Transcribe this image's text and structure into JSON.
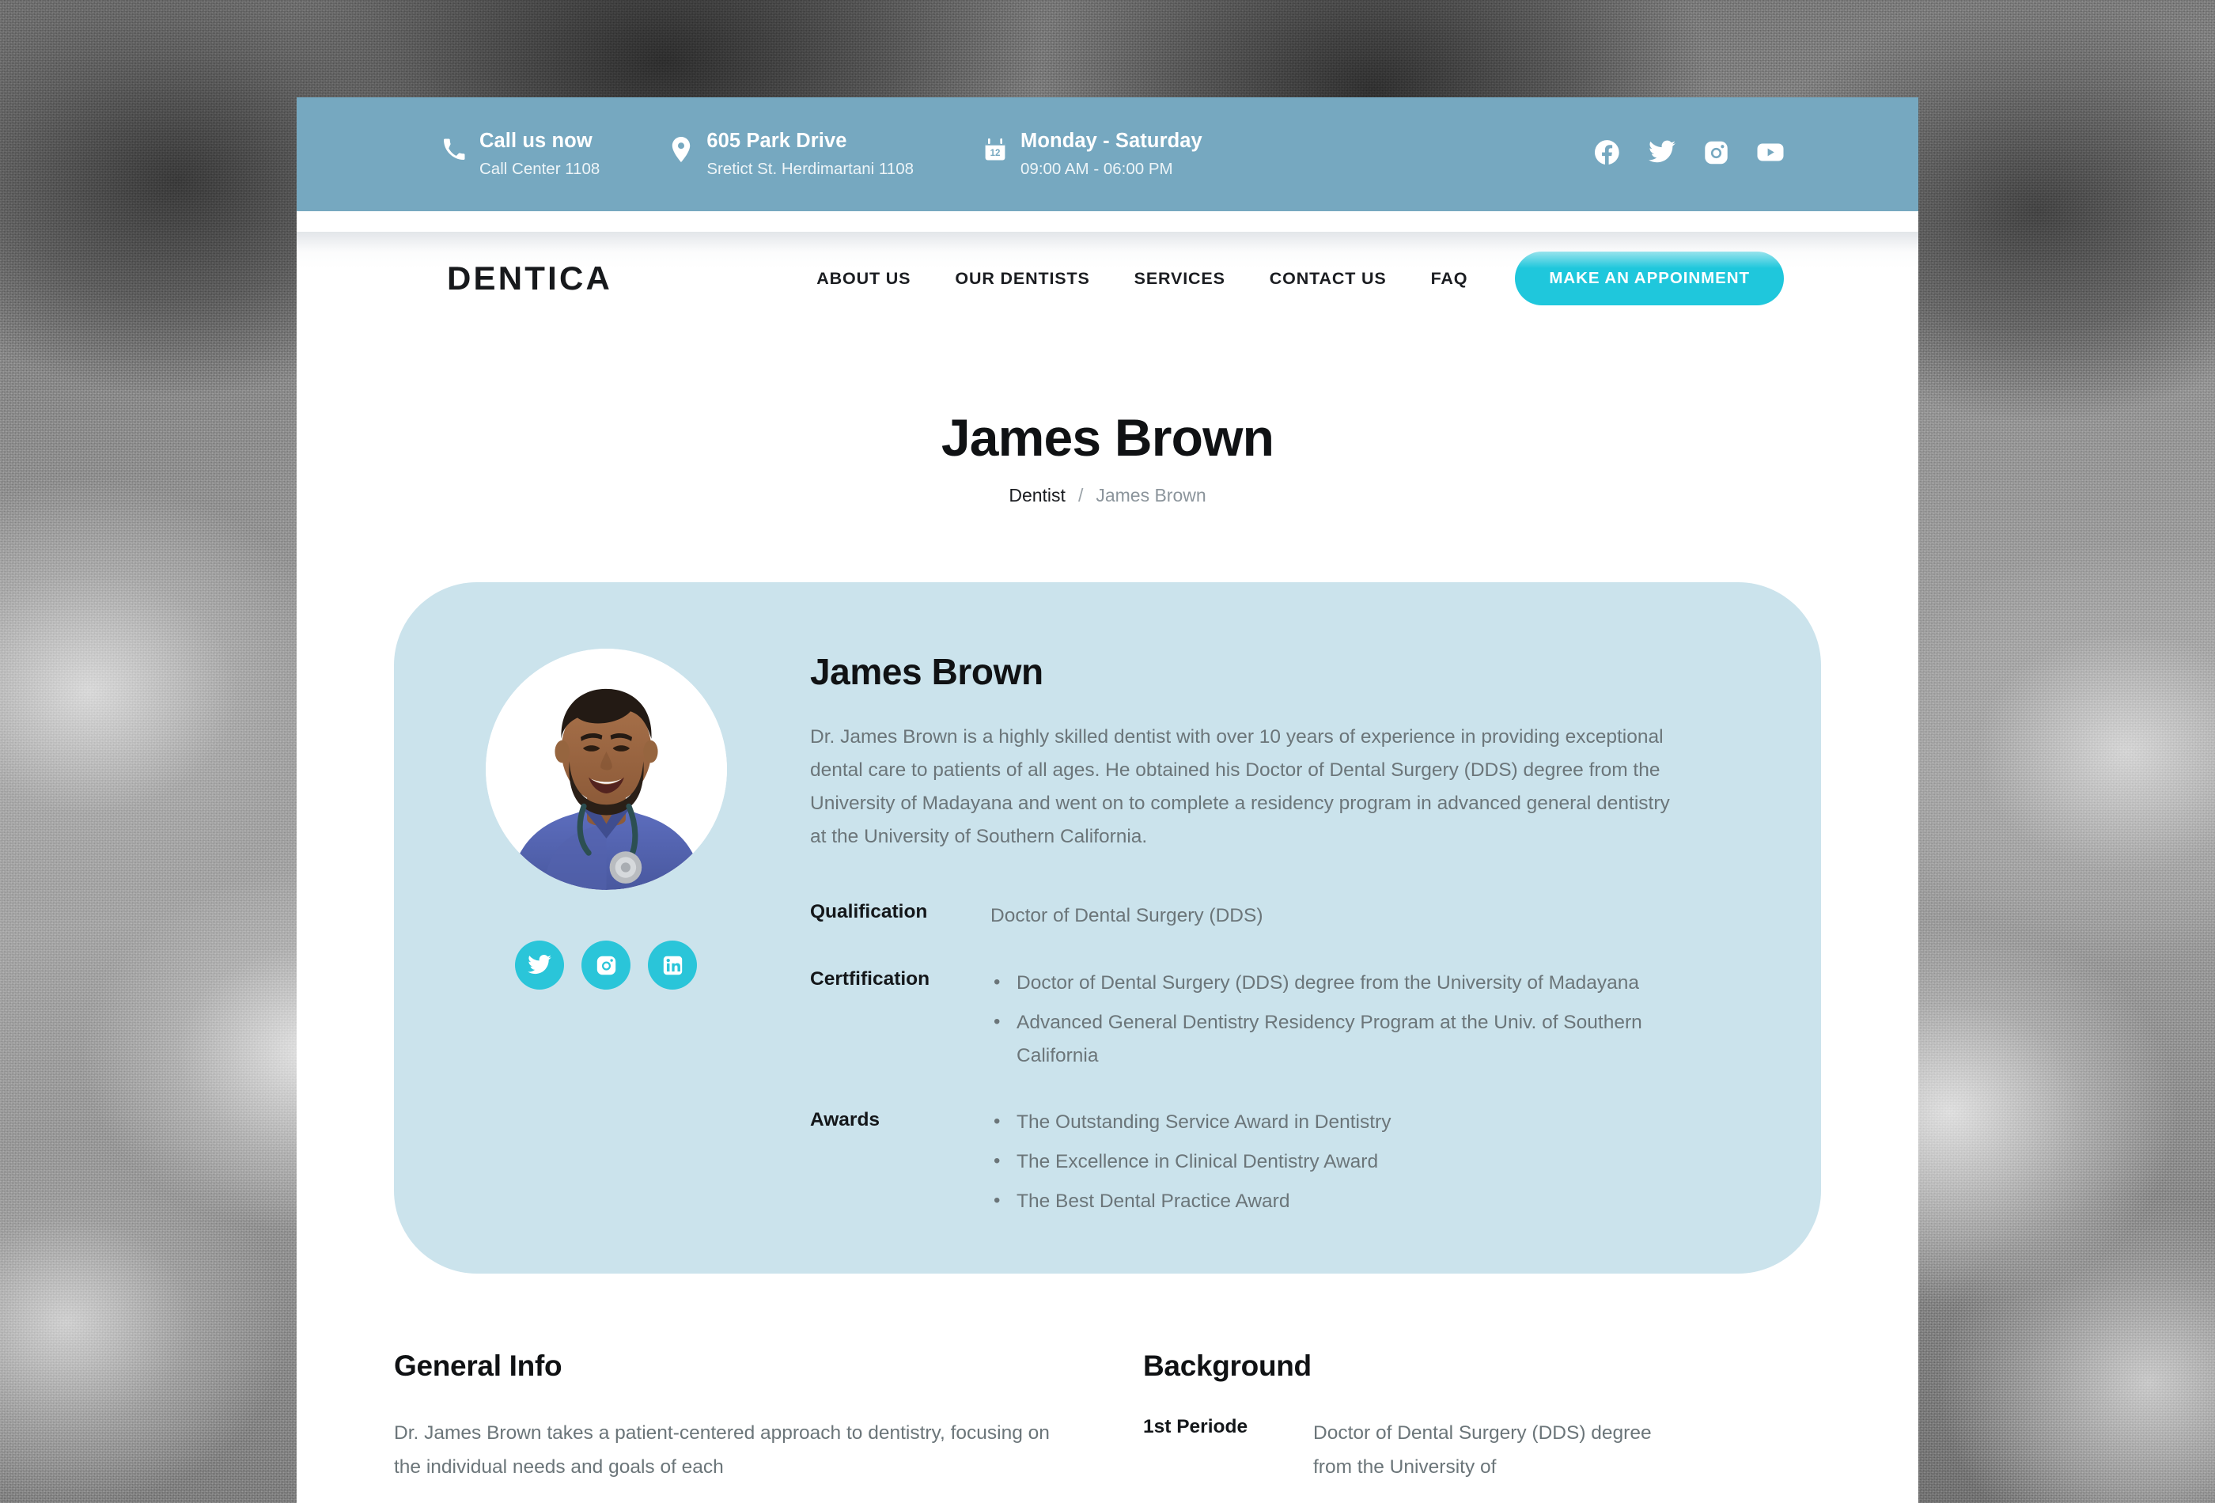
{
  "topbar": {
    "items": [
      {
        "icon": "phone-icon",
        "title": "Call us now",
        "sub": "Call Center 1108"
      },
      {
        "icon": "location-pin-icon",
        "title": "605 Park Drive",
        "sub": "Sretict St. Herdimartani 1108"
      },
      {
        "icon": "calendar-icon",
        "title": "Monday - Saturday",
        "sub": "09:00 AM - 06:00 PM"
      }
    ],
    "social": [
      "facebook-icon",
      "twitter-icon",
      "instagram-icon",
      "youtube-icon"
    ]
  },
  "nav": {
    "logo": "DENTICA",
    "links": [
      "ABOUT US",
      "OUR DENTISTS",
      "SERVICES",
      "CONTACT US",
      "FAQ"
    ],
    "cta": "MAKE AN APPOINMENT"
  },
  "hero": {
    "title": "James Brown",
    "breadcrumb": {
      "parent": "Dentist",
      "separator": "/",
      "current": "James Brown"
    }
  },
  "profile": {
    "name": "James Brown",
    "bio": "Dr. James Brown is a highly skilled dentist with over 10 years of experience in providing exceptional dental care to patients of all ages. He obtained his Doctor of Dental Surgery (DDS) degree from the University of Madayana and went on to complete a residency program in advanced general dentistry at the University of Southern California.",
    "social": [
      "twitter-icon",
      "instagram-icon",
      "linkedin-icon"
    ],
    "qualification_label": "Qualification",
    "qualification_value": "Doctor of Dental Surgery (DDS)",
    "certification_label": "Certfification",
    "certification_items": [
      "Doctor of Dental Surgery (DDS) degree from the University of Madayana",
      "Advanced General Dentistry Residency Program at the Univ. of Southern California"
    ],
    "awards_label": "Awards",
    "awards_items": [
      "The Outstanding Service Award in Dentistry",
      "The Excellence in Clinical Dentistry Award",
      "The Best Dental Practice Award"
    ]
  },
  "general_info": {
    "title": "General Info",
    "body": "Dr. James Brown takes a patient-centered approach to dentistry, focusing on the individual needs and goals of each"
  },
  "background": {
    "title": "Background",
    "period_label": "1st Periode",
    "period_value": "Doctor of Dental Surgery (DDS) degree from the University of"
  },
  "colors": {
    "topbar_blue": "#76A8C0",
    "accent_cyan": "#1FC7DC",
    "card_blue": "#CBE3EC",
    "text_dark": "#101214",
    "text_muted": "#6b7579"
  }
}
